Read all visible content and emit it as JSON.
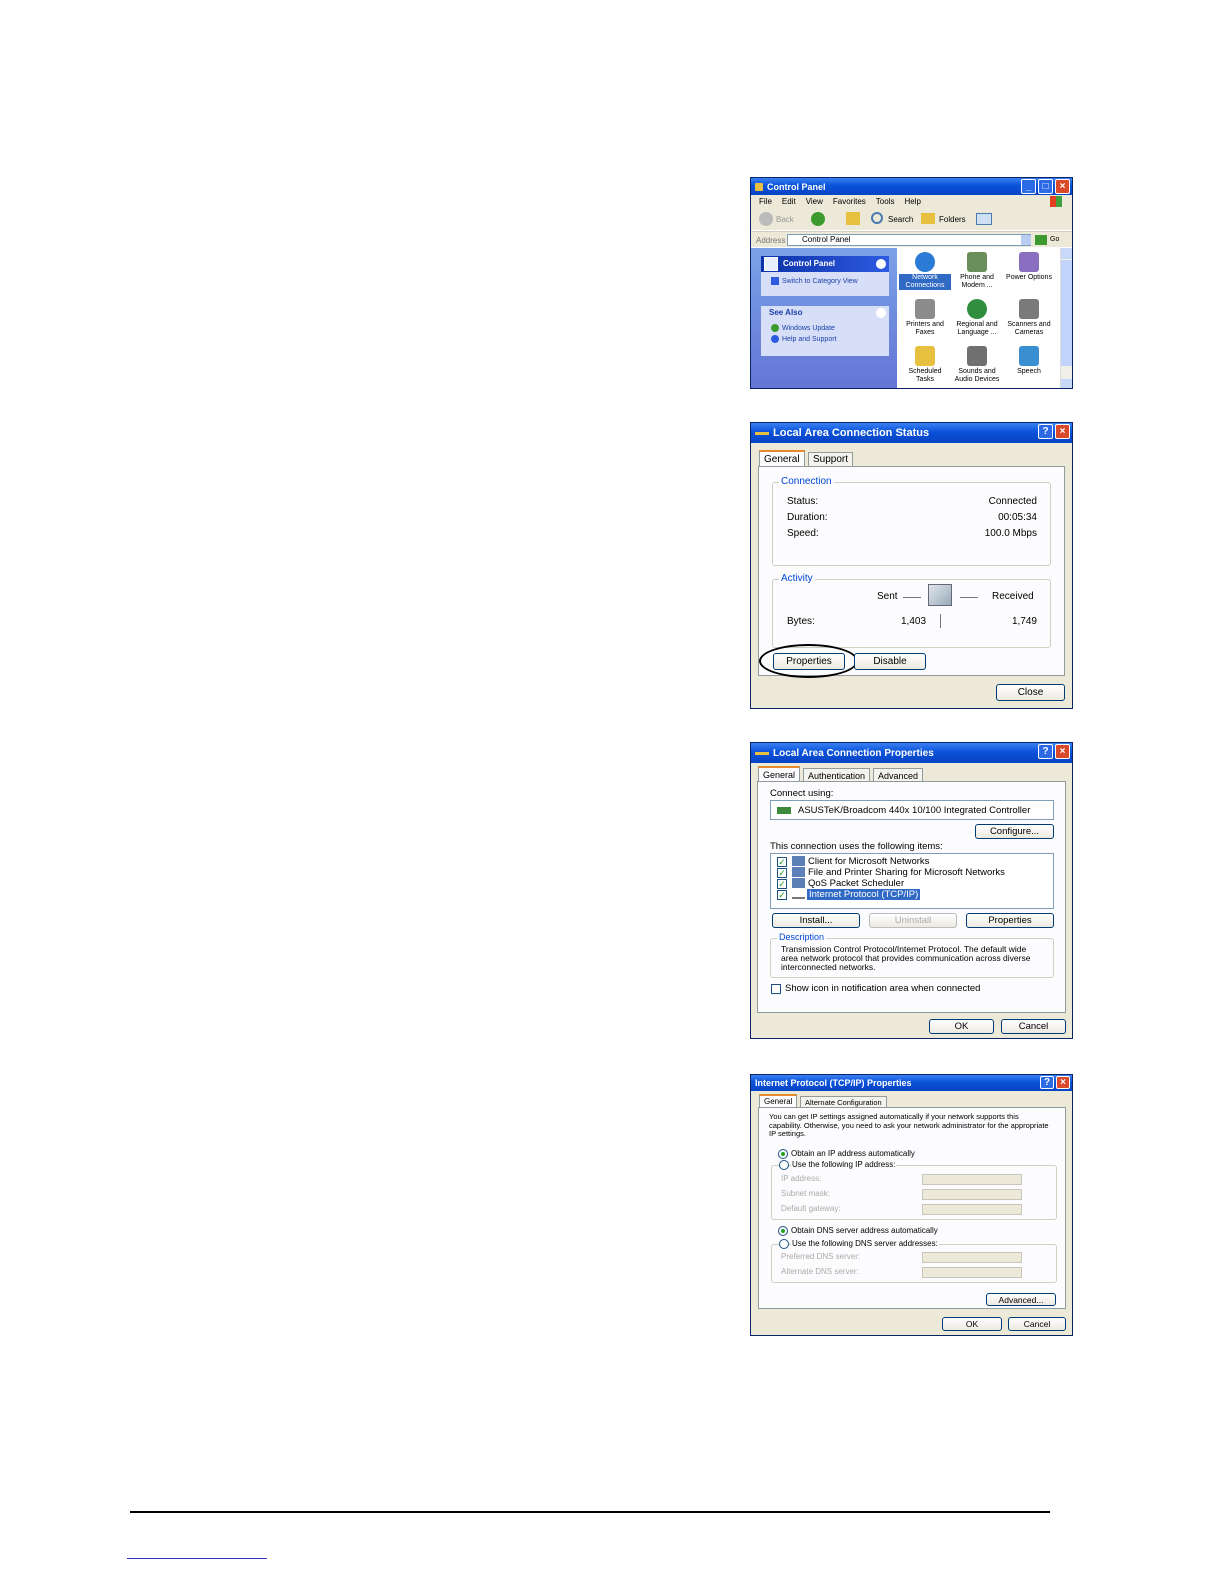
{
  "control_panel": {
    "title": "Control Panel",
    "menu": [
      "File",
      "Edit",
      "View",
      "Favorites",
      "Tools",
      "Help"
    ],
    "toolbar": {
      "back": "Back",
      "search": "Search",
      "folders": "Folders"
    },
    "address_label": "Address",
    "address_value": "Control Panel",
    "go_label": "Go",
    "sidebar": {
      "panel_title": "Control Panel",
      "switch_link": "Switch to Category View",
      "see_also_title": "See Also",
      "see_also_links": [
        "Windows Update",
        "Help and Support"
      ]
    },
    "icons": [
      {
        "label1": "Network",
        "label2": "Connections",
        "icon": "network-globe-icon",
        "color": "#2a7bd6"
      },
      {
        "label1": "Phone and",
        "label2": "Modem ...",
        "icon": "phone-icon",
        "color": "#6a8f5a"
      },
      {
        "label1": "Power Options",
        "label2": "",
        "icon": "power-icon",
        "color": "#8a6fc0"
      },
      {
        "label1": "Printers and",
        "label2": "Faxes",
        "icon": "printer-icon",
        "color": "#8c8c8c"
      },
      {
        "label1": "Regional and",
        "label2": "Language ...",
        "icon": "globe-icon",
        "color": "#2f8f3f"
      },
      {
        "label1": "Scanners and",
        "label2": "Cameras",
        "icon": "scanner-icon",
        "color": "#7a7a7a"
      },
      {
        "label1": "Scheduled",
        "label2": "Tasks",
        "icon": "folder-clock-icon",
        "color": "#e8c040"
      },
      {
        "label1": "Sounds and",
        "label2": "Audio Devices",
        "icon": "speaker-icon",
        "color": "#707070"
      },
      {
        "label1": "Speech",
        "label2": "",
        "icon": "speech-icon",
        "color": "#3a8fd0"
      }
    ]
  },
  "status_dialog": {
    "title": "Local Area Connection Status",
    "tabs": [
      "General",
      "Support"
    ],
    "connection_group": "Connection",
    "rows": [
      {
        "label": "Status:",
        "value": "Connected"
      },
      {
        "label": "Duration:",
        "value": "00:05:34"
      },
      {
        "label": "Speed:",
        "value": "100.0 Mbps"
      }
    ],
    "activity_group": "Activity",
    "sent_label": "Sent",
    "received_label": "Received",
    "bytes_label": "Bytes:",
    "bytes_sent": "1,403",
    "bytes_received": "1,749",
    "properties_button": "Properties",
    "disable_button": "Disable",
    "close_button": "Close"
  },
  "properties_dialog": {
    "title": "Local Area Connection Properties",
    "tabs": [
      "General",
      "Authentication",
      "Advanced"
    ],
    "connect_using_label": "Connect using:",
    "adapter": "ASUSTeK/Broadcom 440x 10/100 Integrated Controller",
    "configure_button": "Configure...",
    "items_label": "This connection uses the following items:",
    "items": [
      "Client for Microsoft Networks",
      "File and Printer Sharing for Microsoft Networks",
      "QoS Packet Scheduler",
      "Internet Protocol (TCP/IP)"
    ],
    "install_button": "Install...",
    "uninstall_button": "Uninstall",
    "properties_button": "Properties",
    "description_group": "Description",
    "description_text": "Transmission Control Protocol/Internet Protocol. The default wide area network protocol that provides communication across diverse interconnected networks.",
    "show_icon_label": "Show icon in notification area when connected",
    "ok_button": "OK",
    "cancel_button": "Cancel"
  },
  "tcpip_dialog": {
    "title": "Internet Protocol (TCP/IP) Properties",
    "tabs": [
      "General",
      "Alternate Configuration"
    ],
    "intro_text": "You can get IP settings assigned automatically if your network supports this capability. Otherwise, you need to ask your network administrator for the appropriate IP settings.",
    "obtain_ip": "Obtain an IP address automatically",
    "use_ip": "Use the following IP address:",
    "ip_fields": [
      "IP address:",
      "Subnet mask:",
      "Default gateway:"
    ],
    "obtain_dns": "Obtain DNS server address automatically",
    "use_dns": "Use the following DNS server addresses:",
    "dns_fields": [
      "Preferred DNS server:",
      "Alternate DNS server:"
    ],
    "advanced_button": "Advanced...",
    "ok_button": "OK",
    "cancel_button": "Cancel"
  }
}
